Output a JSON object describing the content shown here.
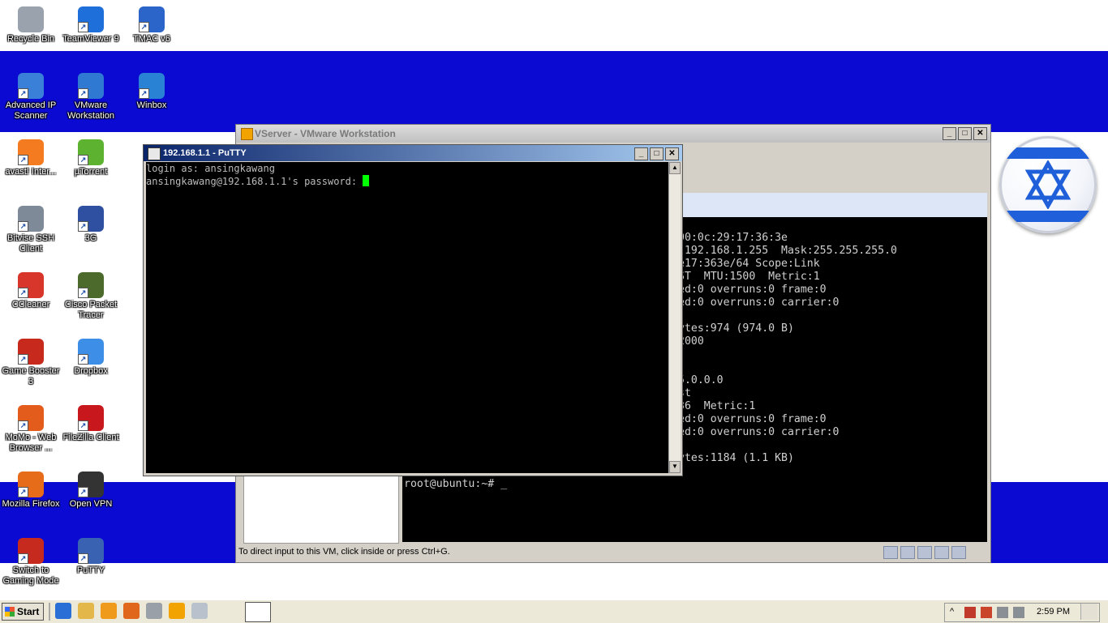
{
  "desktop": {
    "icons": [
      {
        "label": "Recycle Bin",
        "icon": "recycle-bin-icon",
        "color": "#9aa3ad"
      },
      {
        "label": "TeamViewer 9",
        "icon": "teamviewer-icon",
        "color": "#1e6fd9"
      },
      {
        "label": "TMAC v6",
        "icon": "tmac-icon",
        "color": "#2b65c9"
      },
      {
        "label": "Advanced IP Scanner",
        "icon": "advanced-ip-scanner-icon",
        "color": "#3a7fd8"
      },
      {
        "label": "VMware Workstation",
        "icon": "vmware-icon",
        "color": "#2f79d2"
      },
      {
        "label": "Winbox",
        "icon": "winbox-icon",
        "color": "#2a82d4"
      },
      {
        "label": "avast! Inter...",
        "icon": "avast-icon",
        "color": "#f47b20"
      },
      {
        "label": "µTorrent",
        "icon": "utorrent-icon",
        "color": "#5db22f"
      },
      {
        "label": "Bitvise SSH Client",
        "icon": "bitvise-icon",
        "color": "#7f8a99"
      },
      {
        "label": "3G",
        "icon": "modem-icon",
        "color": "#2f4fa1"
      },
      {
        "label": "CCleaner",
        "icon": "ccleaner-icon",
        "color": "#d8362b"
      },
      {
        "label": "Cisco Packet Tracer",
        "icon": "packet-tracer-icon",
        "color": "#4c6a2c"
      },
      {
        "label": "Game Booster 3",
        "icon": "game-booster-icon",
        "color": "#c7291d"
      },
      {
        "label": "Dropbox",
        "icon": "dropbox-icon",
        "color": "#3d8ee6"
      },
      {
        "label": "MoMo - Web Browser ...",
        "icon": "momo-icon",
        "color": "#e45c1c"
      },
      {
        "label": "FileZilla Client",
        "icon": "filezilla-icon",
        "color": "#c8171d"
      },
      {
        "label": "Mozilla Firefox",
        "icon": "firefox-icon",
        "color": "#e66c1a"
      },
      {
        "label": "Open VPN",
        "icon": "openvpn-icon",
        "color": "#333333"
      },
      {
        "label": "Switch to Gaming Mode",
        "icon": "gaming-mode-icon",
        "color": "#c62a1e"
      },
      {
        "label": "PuTTY",
        "icon": "putty-icon",
        "color": "#3a62b3"
      }
    ]
  },
  "vmware": {
    "title": "VServer - VMware Workstation",
    "console_lines": [
      "00:0c:29:17:36:3e",
      ":192.168.1.255  Mask:255.255.255.0",
      "e17:363e/64 Scope:Link",
      "ST  MTU:1500  Metric:1",
      "ed:0 overruns:0 frame:0",
      "ed:0 overruns:0 carrier:0",
      "",
      "ytes:974 (974.0 B)",
      "2000",
      "",
      "",
      "5.0.0.0",
      "st",
      "36  Metric:1",
      "ed:0 overruns:0 frame:0",
      "ed:0 overruns:0 carrier:0",
      "",
      "ytes:1184 (1.1 KB)"
    ],
    "prompt": "root@ubuntu:~# _",
    "status": "To direct input to this VM, click inside or press Ctrl+G."
  },
  "putty": {
    "title": "192.168.1.1 - PuTTY",
    "line1": "login as: ansingkawang",
    "line2": "ansingkawang@192.168.1.1's password: "
  },
  "taskbar": {
    "start_label": "Start",
    "clock": "2:59 PM"
  },
  "colors": {
    "band_blue": "#0a0ad2",
    "cursor_green": "#00ff00"
  }
}
